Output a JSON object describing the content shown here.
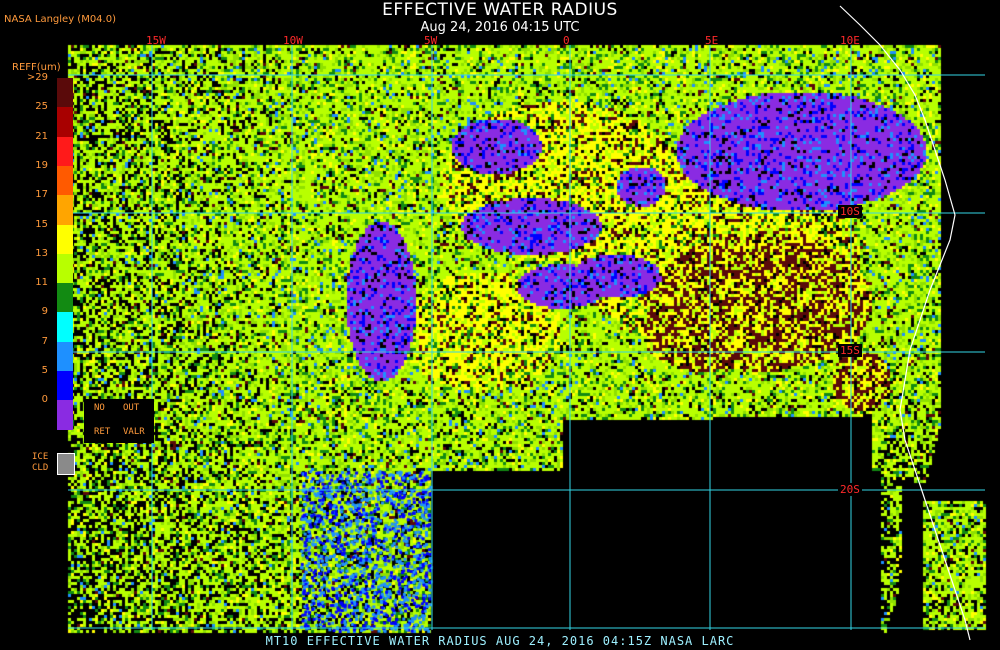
{
  "header": {
    "title": "EFFECTIVE WATER RADIUS",
    "subtitle": "Aug 24, 2016 04:15 UTC",
    "org": "NASA Langley (M04.0)"
  },
  "map": {
    "longitude_labels": [
      "15W",
      "10W",
      "5W",
      "0",
      "5E",
      "10E"
    ],
    "latitude_labels": [
      "10S",
      "15S",
      "20S"
    ],
    "grid_color": "#33d6e6",
    "coast_color": "#ffffff",
    "no_data_color": "#000000"
  },
  "legend": {
    "title": "REFF(um)",
    "ticks": [
      ">29",
      "25",
      "21",
      "19",
      "17",
      "15",
      "13",
      "11",
      "9",
      "7",
      "5",
      "0"
    ],
    "colors": [
      "#5a0a0a",
      "#a80000",
      "#ff1a1a",
      "#ff5a00",
      "#ffa500",
      "#ffff00",
      "#b8ff00",
      "#128a12",
      "#00ffff",
      "#1e90ff",
      "#0000ff",
      "#8a2be2"
    ],
    "no_ret_label": "NO\nRET",
    "out_valr_label": "OUT\nVALR",
    "no_label": "NO",
    "ret_label": "RET",
    "out_label": "OUT",
    "valr_label": "VALR",
    "ice_label_1": "ICE",
    "ice_label_2": "CLD",
    "ice_color": "#8a8a8a"
  },
  "footer": {
    "text": "MT10  EFFECTIVE WATER RADIUS  AUG 24, 2016 04:15Z  NASA LARC"
  }
}
